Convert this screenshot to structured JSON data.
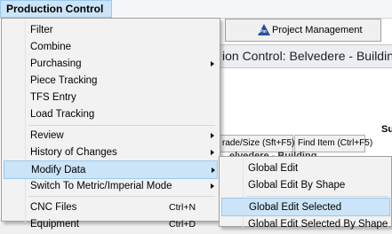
{
  "menubar": {
    "active_menu": "Production Control"
  },
  "app": {
    "pm_tab_label": "Project Management",
    "pm_logo_text": "Pm",
    "header_title": "ion Control: Belvedere - Building",
    "side_text": "Sur",
    "buttons": {
      "grade_size": "rade/Size (Sft+F5)",
      "find_item": "Find Item (Ctrl+F5)"
    },
    "sub_header": "elvedere - Building"
  },
  "main_menu": {
    "items": [
      {
        "label": "Filter"
      },
      {
        "label": "Combine"
      },
      {
        "label": "Purchasing"
      },
      {
        "label": "Piece Tracking"
      },
      {
        "label": "TFS Entry"
      },
      {
        "label": "Load Tracking"
      },
      {
        "label": "Review"
      },
      {
        "label": "History of Changes"
      },
      {
        "label": "Modify Data"
      },
      {
        "label": "Switch To Metric/Imperial Mode"
      },
      {
        "label": "CNC Files",
        "shortcut": "Ctrl+N"
      },
      {
        "label": "Equipment",
        "shortcut": "Ctrl+D"
      }
    ]
  },
  "sub_menu": {
    "items": [
      {
        "label": "Global Edit"
      },
      {
        "label": "Global Edit By Shape"
      },
      {
        "label": "Global Edit Selected"
      },
      {
        "label": "Global Edit Selected By Shape"
      }
    ]
  },
  "colors": {
    "highlight": "#cce4f7",
    "highlight_border": "#99c9ef",
    "logo": "#2b4fa0"
  }
}
